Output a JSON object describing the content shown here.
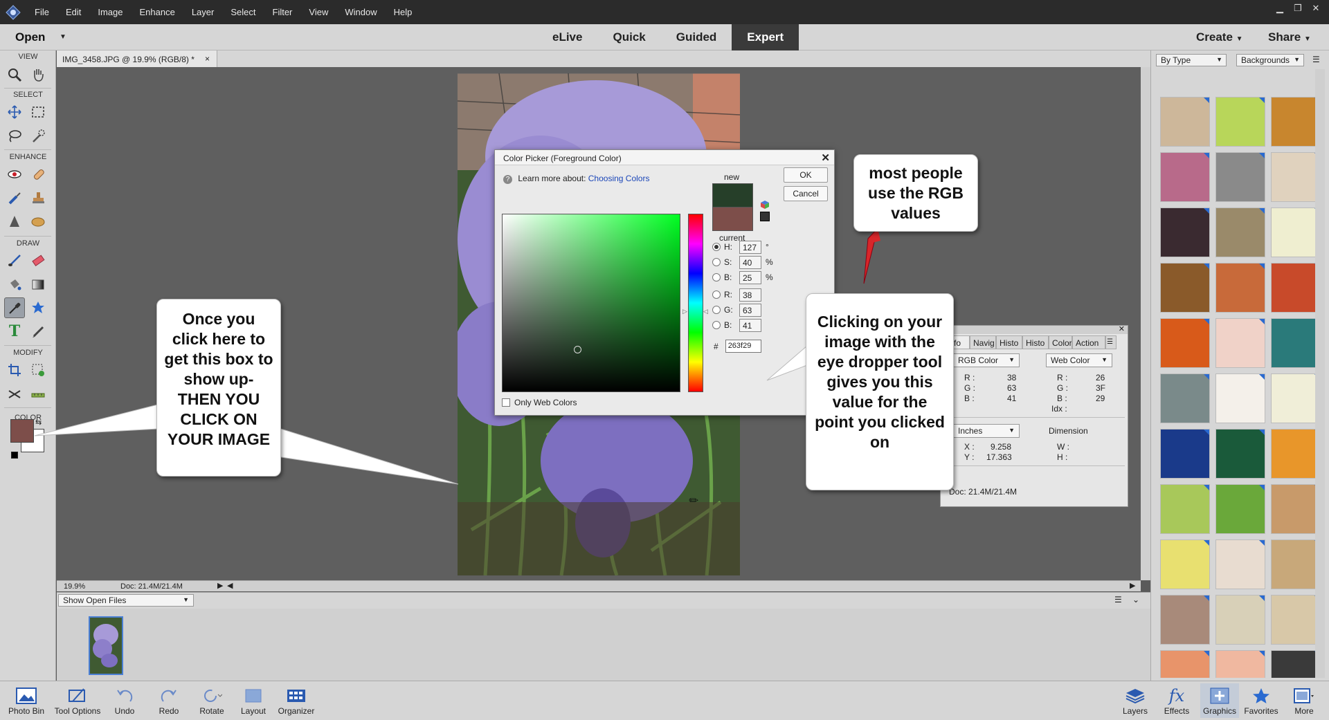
{
  "menubar": {
    "items": [
      "File",
      "Edit",
      "Image",
      "Enhance",
      "Layer",
      "Select",
      "Filter",
      "View",
      "Window",
      "Help"
    ],
    "window_controls": [
      "minimize",
      "restore",
      "close"
    ]
  },
  "modebar": {
    "open_label": "Open",
    "tabs": [
      "eLive",
      "Quick",
      "Guided",
      "Expert"
    ],
    "active_tab": "Expert",
    "create_label": "Create",
    "share_label": "Share"
  },
  "toolbox": {
    "sections": {
      "view": "VIEW",
      "select": "SELECT",
      "enhance": "ENHANCE",
      "draw": "DRAW",
      "modify": "MODIFY",
      "color": "COLOR"
    },
    "foreground_color": "#7d4e4a",
    "background_color": "#ffffff"
  },
  "document": {
    "tab_title": "IMG_3458.JPG @ 19.9% (RGB/8) *",
    "tab_close": "×",
    "zoom": "19.9%",
    "doc_size": "Doc: 21.4M/21.4M"
  },
  "photo_bin": {
    "dropdown": "Show Open Files"
  },
  "right_panel": {
    "filter_type": "By Type",
    "category": "Backgrounds"
  },
  "color_picker": {
    "title": "Color Picker (Foreground Color)",
    "learn_prefix": "Learn more about:",
    "learn_link": "Choosing Colors",
    "new_label": "new",
    "current_label": "current",
    "ok_label": "OK",
    "cancel_label": "Cancel",
    "new_color": "#263f29",
    "current_color": "#7d4e4a",
    "fields": {
      "H": "127",
      "S": "40",
      "B_hsb": "25",
      "R": "38",
      "G": "63",
      "B": "41"
    },
    "units": {
      "deg": "°",
      "pct": "%"
    },
    "hash": "#",
    "hex": "263f29",
    "only_web_colors": "Only Web Colors"
  },
  "info_panel": {
    "tabs": [
      "Info",
      "Navig",
      "Histo",
      "Histo",
      "Color",
      "Action"
    ],
    "left_mode": "RGB Color",
    "right_mode": "Web Color",
    "left_values": {
      "R": "38",
      "G": "63",
      "B": "41"
    },
    "right_values": {
      "R": "26",
      "G": "3F",
      "B": "29"
    },
    "idx_label": "Idx :",
    "units": "Inches",
    "x": "9.258",
    "y": "17.363",
    "dimension_label": "Dimension",
    "w_label": "W :",
    "h_label": "H :",
    "doc": "Doc: 21.4M/21.4M"
  },
  "taskbar": {
    "left": [
      "Photo Bin",
      "Tool Options",
      "Undo",
      "Redo",
      "Rotate",
      "Layout",
      "Organizer"
    ],
    "right": [
      "Layers",
      "Effects",
      "Graphics",
      "Favorites",
      "More"
    ]
  },
  "callouts": {
    "left": "Once you click here to get this box to show up- THEN YOU CLICK ON YOUR IMAGE",
    "right": "Clicking on your image with the eye dropper tool gives you this value for the point you clicked on",
    "top": "most people use the RGB values"
  }
}
